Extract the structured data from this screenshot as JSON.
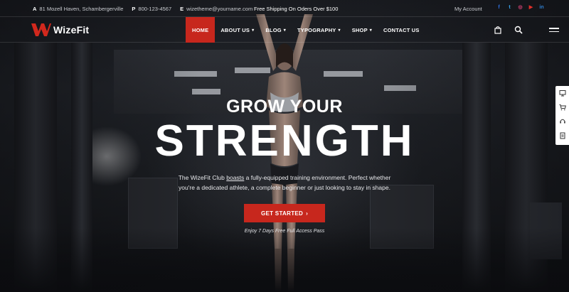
{
  "topbar": {
    "address_prefix": "A",
    "address": "81 Mozell Haven, Schambergerville",
    "phone_prefix": "P",
    "phone": "800-123-4567",
    "email_prefix": "E",
    "email": "wizetheme@yourname.com",
    "shipping": "Free Shipping On Oders Over $100",
    "account": "My Account",
    "socials": [
      {
        "icon": "facebook-icon",
        "glyph": "f",
        "color": "#2f6fe0"
      },
      {
        "icon": "twitter-icon",
        "glyph": "t",
        "color": "#3aa6f0"
      },
      {
        "icon": "instagram-icon",
        "glyph": "◎",
        "color": "#e0457a"
      },
      {
        "icon": "youtube-icon",
        "glyph": "▶",
        "color": "#e2302a"
      },
      {
        "icon": "linkedin-icon",
        "glyph": "in",
        "color": "#2f7fd0"
      }
    ]
  },
  "nav": {
    "logo_text": "WizeFit",
    "items": [
      {
        "label": "HOME",
        "dropdown": false
      },
      {
        "label": "ABOUT US",
        "dropdown": true
      },
      {
        "label": "BLOG",
        "dropdown": true
      },
      {
        "label": "TYPOGRAPHY",
        "dropdown": true
      },
      {
        "label": "SHOP",
        "dropdown": true
      },
      {
        "label": "CONTACT US",
        "dropdown": false
      }
    ],
    "cart_icon": "shopping-bag-icon",
    "search_icon": "search-icon",
    "menu_icon": "hamburger-icon"
  },
  "hero": {
    "headline_small": "GROW YOUR",
    "headline_big": "STRENGTH",
    "description_1": "The WizeFit Club ",
    "description_link": "boasts",
    "description_2": " a fully-equipped training environment. Perfect whether you're a dedicated athlete, a complete beginner or just looking to stay in shape.",
    "cta_label": "GET STARTED",
    "cta_note": "Enjoy 7 Days Free Full Access Pass"
  },
  "side_tools": [
    "monitor-icon",
    "cart-icon",
    "support-icon",
    "document-icon"
  ],
  "colors": {
    "accent": "#c7271d",
    "background": "#121317",
    "text": "#ffffff"
  }
}
